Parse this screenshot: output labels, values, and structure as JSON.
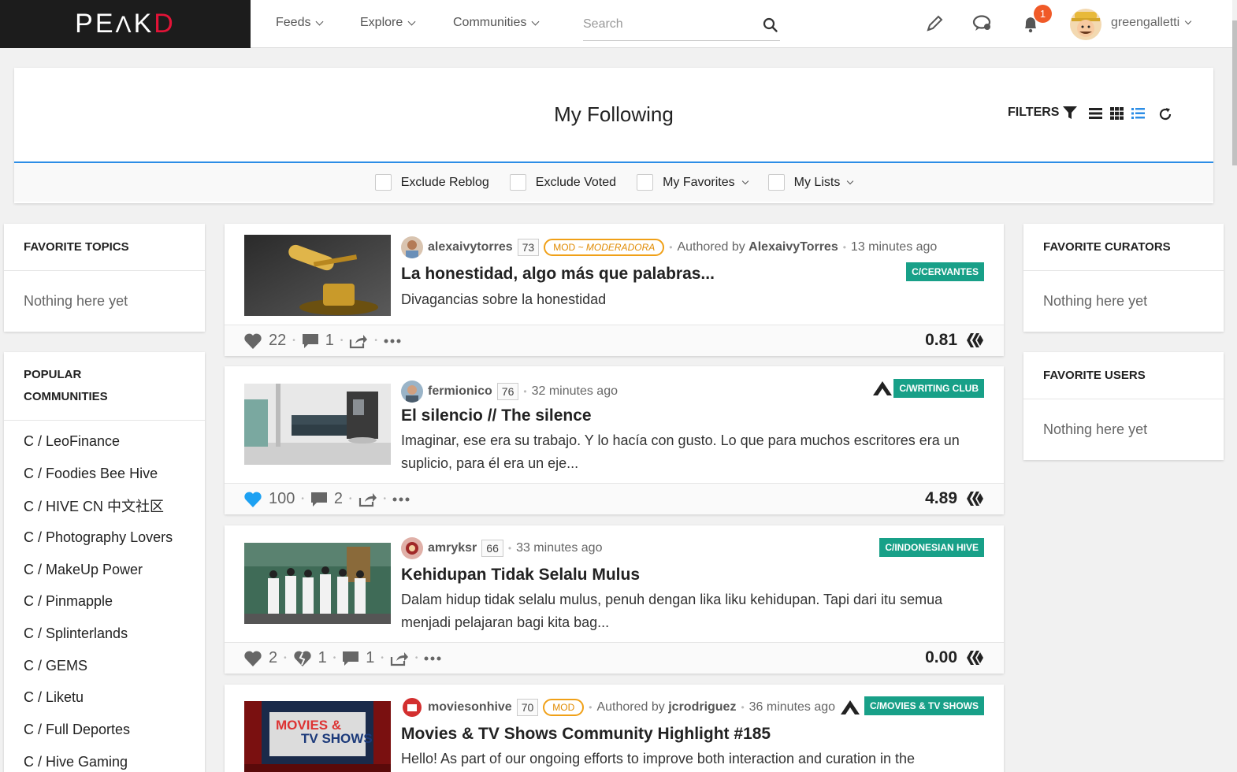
{
  "brand": {
    "logo": "PEAKD"
  },
  "nav": {
    "feeds": "Feeds",
    "explore": "Explore",
    "communities": "Communities",
    "search_placeholder": "Search",
    "notification_count": "1",
    "username": "greengalletti"
  },
  "header": {
    "title": "My Following",
    "filters_label": "FILTERS",
    "options": [
      "Exclude Reblog",
      "Exclude Voted",
      "My Favorites",
      "My Lists"
    ]
  },
  "left": {
    "favorite_topics": {
      "title": "FAVORITE TOPICS",
      "empty": "Nothing here yet"
    },
    "popular_communities": {
      "title_line1": "POPULAR",
      "title_line2": "COMMUNITIES",
      "items": [
        "C / LeoFinance",
        "C / Foodies Bee Hive",
        "C / HIVE CN 中文社区",
        "C / Photography Lovers",
        "C / MakeUp Power",
        "C / Pinmapple",
        "C / Splinterlands",
        "C / GEMS",
        "C / Liketu",
        "C / Full Deportes",
        "C / Hive Gaming"
      ]
    }
  },
  "right": {
    "favorite_curators": {
      "title": "FAVORITE CURATORS",
      "empty": "Nothing here yet"
    },
    "favorite_users": {
      "title": "FAVORITE USERS",
      "empty": "Nothing here yet"
    }
  },
  "posts": [
    {
      "author": "alexaivytorres",
      "rep": "73",
      "mod_prefix": "MOD",
      "mod_role": " ~ MODERADORA",
      "authored_prefix": "Authored by",
      "authored_by": "AlexaivyTorres",
      "time": "13 minutes ago",
      "community": "C/CERVANTES",
      "title": "La honestidad, algo más que palabras...",
      "body": "Divagancias sobre la honestidad",
      "votes": "22",
      "comments": "1",
      "payout": "0.81"
    },
    {
      "author": "fermionico",
      "rep": "76",
      "time": "32 minutes ago",
      "community": "C/WRITING CLUB",
      "title": "El silencio // The silence",
      "body": "Imaginar, ese era su trabajo. Y lo hacía con gusto. Lo que para muchos escritores era un suplicio, para él era un eje...",
      "votes": "100",
      "comments": "2",
      "payout": "4.89"
    },
    {
      "author": "amryksr",
      "rep": "66",
      "time": "33 minutes ago",
      "community": "C/INDONESIAN HIVE",
      "title": "Kehidupan Tidak Selalu Mulus",
      "body": "Dalam hidup tidak selalu mulus, penuh dengan lika liku kehidupan. Tapi dari itu semua menjadi pelajaran bagi kita bag...",
      "votes": "2",
      "downvotes": "1",
      "comments": "1",
      "payout": "0.00"
    },
    {
      "author": "moviesonhive",
      "rep": "70",
      "mod_prefix": "MOD",
      "authored_prefix": "Authored by",
      "authored_by": "jcrodriguez",
      "time": "36 minutes ago",
      "community": "C/MOVIES & TV SHOWS",
      "title": "Movies & TV Shows Community Highlight #185",
      "body": "Hello! As part of our ongoing efforts to improve both interaction and curation in the",
      "thumb_line1": "MOVIES &",
      "thumb_line2": "TV SHOWS"
    }
  ],
  "colors": {
    "accent": "#2c8de6",
    "brand_red": "#e31337",
    "community_bg": "#18a088",
    "mod": "#f0a017",
    "badge": "#f05a28",
    "upvote_active": "#1da1f2"
  }
}
